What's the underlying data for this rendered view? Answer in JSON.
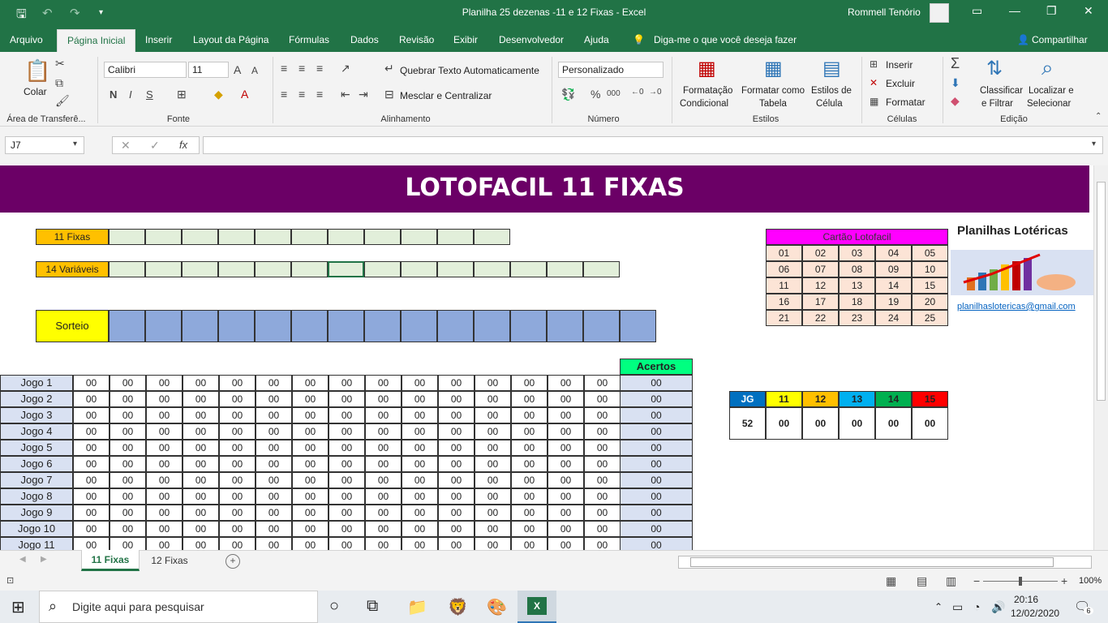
{
  "titlebar": {
    "title": "Planilha 25 dezenas -11 e 12 Fixas  -  Excel",
    "user": "Rommell Tenório",
    "min": "—",
    "restore": "❐",
    "close": "✕",
    "ribbon_opts": "▭"
  },
  "menu": {
    "tabs": [
      "Arquivo",
      "Página Inicial",
      "Inserir",
      "Layout da Página",
      "Fórmulas",
      "Dados",
      "Revisão",
      "Exibir",
      "Desenvolvedor",
      "Ajuda"
    ],
    "tell": "Diga-me o que você deseja fazer",
    "share": "Compartilhar"
  },
  "ribbon": {
    "clipboard": {
      "paste": "Colar",
      "group": "Área de Transferê..."
    },
    "font": {
      "name": "Calibri",
      "size": "11",
      "bold": "N",
      "italic": "I",
      "underline": "S",
      "group": "Fonte"
    },
    "align": {
      "wrap": "Quebrar Texto Automaticamente",
      "merge": "Mesclar e Centralizar",
      "group": "Alinhamento"
    },
    "number": {
      "format": "Personalizado",
      "group": "Número"
    },
    "styles": {
      "cond1": "Formatação",
      "cond2": "Condicional",
      "table1": "Formatar como",
      "table2": "Tabela",
      "cell1": "Estilos de",
      "cell2": "Célula",
      "group": "Estilos"
    },
    "cells": {
      "insert": "Inserir",
      "delete": "Excluir",
      "format": "Formatar",
      "group": "Células"
    },
    "edit": {
      "sort1": "Classificar",
      "sort2": "e Filtrar",
      "find1": "Localizar e",
      "find2": "Selecionar",
      "group": "Edição"
    }
  },
  "formulabar": {
    "namebox": "J7",
    "value": ""
  },
  "sheet": {
    "banner": "LOTOFACIL 11 FIXAS",
    "fixas_label": "11 Fixas",
    "variaveis_label": "14 Variáveis",
    "sorteio_label": "Sorteio",
    "acertos_header": "Acertos",
    "jogos": [
      "Jogo 1",
      "Jogo 2",
      "Jogo 3",
      "Jogo 4",
      "Jogo 5",
      "Jogo 6",
      "Jogo 7",
      "Jogo 8",
      "Jogo 9",
      "Jogo 10",
      "Jogo 11"
    ],
    "zero": "00",
    "cartao_title": "Cartão Lotofacil",
    "cartao": [
      [
        "01",
        "02",
        "03",
        "04",
        "05"
      ],
      [
        "06",
        "07",
        "08",
        "09",
        "10"
      ],
      [
        "11",
        "12",
        "13",
        "14",
        "15"
      ],
      [
        "16",
        "17",
        "18",
        "19",
        "20"
      ],
      [
        "21",
        "22",
        "23",
        "24",
        "25"
      ]
    ],
    "summary_headers": [
      "JG",
      "11",
      "12",
      "13",
      "14",
      "15"
    ],
    "summary_values": [
      "52",
      "00",
      "00",
      "00",
      "00",
      "00"
    ],
    "summary_colors": [
      "#0070c0",
      "#ffff00",
      "#ffc000",
      "#00b0f0",
      "#00b050",
      "#ff0000"
    ],
    "brand": "Planilhas Lotéricas",
    "email": "planilhaslotericas@gmail.com"
  },
  "sheettabs": {
    "tabs": [
      "11 Fixas",
      "12 Fixas"
    ],
    "add": "+"
  },
  "status": {
    "zoom": "100%"
  },
  "taskbar": {
    "search": "Digite aqui para pesquisar",
    "time": "20:16",
    "date": "12/02/2020",
    "notif": "6"
  }
}
